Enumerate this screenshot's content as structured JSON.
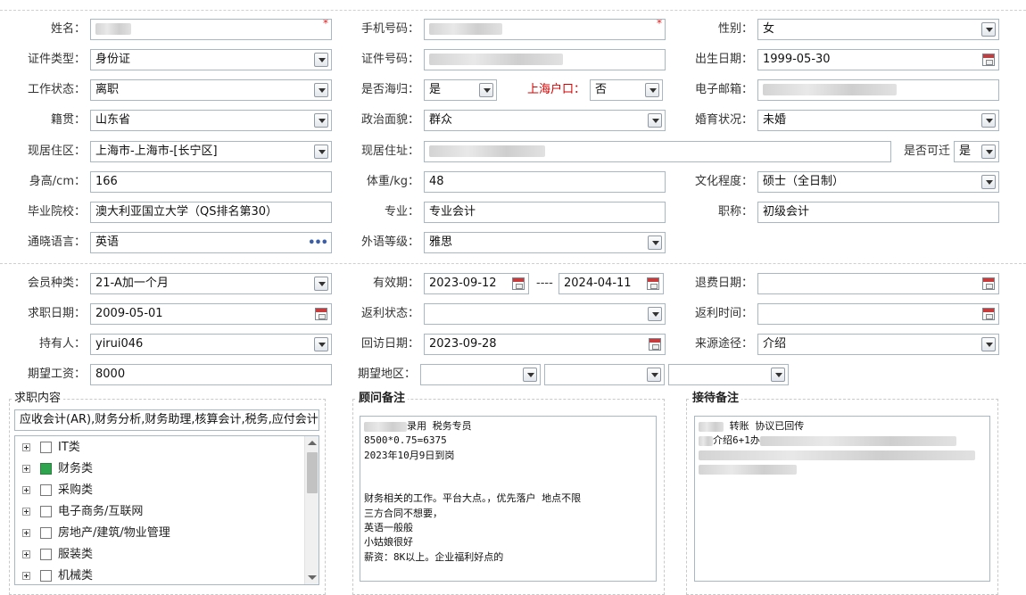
{
  "colors": {
    "label": "#333333",
    "required": "#e02020",
    "warn_label": "#d40000",
    "border": "#a9b6c3",
    "checked": "#2fa44f"
  },
  "profile": {
    "name_label": "姓名：",
    "mobile_label": "手机号码：",
    "gender_label": "性别：",
    "gender_value": "女",
    "id_type_label": "证件类型：",
    "id_type_value": "身份证",
    "id_no_label": "证件号码：",
    "birth_label": "出生日期：",
    "birth_value": "1999-05-30",
    "work_status_label": "工作状态：",
    "work_status_value": "离职",
    "returnee_label": "是否海归：",
    "returnee_value": "是",
    "shanghai_hukou_label": "上海户口：",
    "shanghai_hukou_value": "否",
    "email_label": "电子邮箱：",
    "origin_label": "籍贯：",
    "origin_value": "山东省",
    "political_label": "政治面貌：",
    "political_value": "群众",
    "marital_label": "婚育状况：",
    "marital_value": "未婚",
    "residence_area_label": "现居住区：",
    "residence_area_value": "上海市-上海市-[长宁区]",
    "address_label": "现居住址：",
    "relocate_label": "是否可迁",
    "relocate_value": "是",
    "height_label": "身高/cm：",
    "height_value": "166",
    "weight_label": "体重/kg：",
    "weight_value": "48",
    "education_label": "文化程度：",
    "education_value": "硕士（全日制）",
    "school_label": "毕业院校：",
    "school_value": "澳大利亚国立大学（QS排名第30）",
    "major_label": "专业：",
    "major_value": "专业会计",
    "title_label": "职称：",
    "title_value": "初级会计",
    "language_label": "通晓语言：",
    "language_value": "英语",
    "foreign_level_label": "外语等级：",
    "foreign_level_value": "雅思"
  },
  "membership": {
    "type_label": "会员种类：",
    "type_value": "21-A加一个月",
    "valid_label": "有效期：",
    "valid_from": "2023-09-12",
    "valid_sep": "----",
    "valid_to": "2024-04-11",
    "refund_date_label": "退费日期：",
    "job_date_label": "求职日期：",
    "job_date_value": "2009-05-01",
    "rebate_status_label": "返利状态：",
    "rebate_time_label": "返利时间：",
    "holder_label": "持有人：",
    "holder_value": "yirui046",
    "visit_date_label": "回访日期：",
    "visit_date_value": "2023-09-28",
    "source_label": "来源途径：",
    "source_value": "介绍",
    "salary_label": "期望工资：",
    "salary_value": "8000",
    "region_label": "期望地区："
  },
  "job_content": {
    "title": "求职内容",
    "summary": "应收会计(AR),财务分析,财务助理,核算会计,税务,应付会计",
    "tree": [
      {
        "label": "IT类",
        "checked": false
      },
      {
        "label": "财务类",
        "checked": true
      },
      {
        "label": "采购类",
        "checked": false
      },
      {
        "label": "电子商务/互联网",
        "checked": false
      },
      {
        "label": "房地产/建筑/物业管理",
        "checked": false
      },
      {
        "label": "服装类",
        "checked": false
      },
      {
        "label": "机械类",
        "checked": false
      }
    ]
  },
  "advisor_notes": {
    "title": "顾问备注",
    "lines": [
      "录用 税务专员",
      "8500*0.75=6375",
      "2023年10月9日到岗",
      "",
      "",
      "财务相关的工作。平台大点。，优先落户 地点不限",
      "三方合同不想要，",
      "英语一般般",
      "小姑娘很好",
      "薪资：8K以上。企业福利好点的"
    ]
  },
  "reception_notes": {
    "title": "接待备注",
    "lines": [
      "转账 协议已回传",
      "介绍6+1办"
    ]
  }
}
